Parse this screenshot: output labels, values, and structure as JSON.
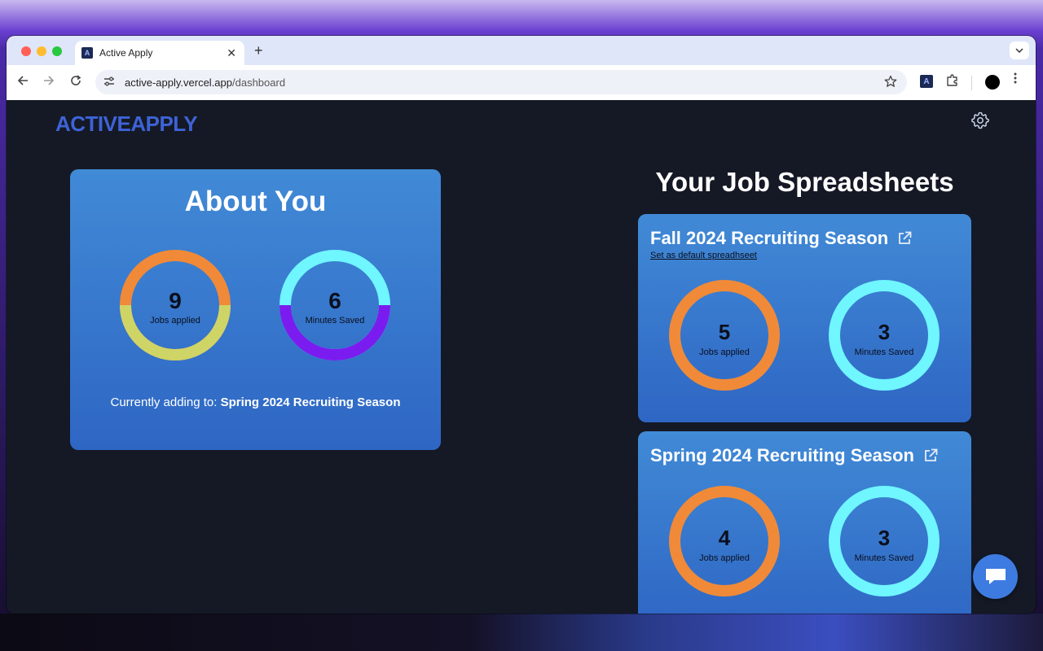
{
  "browser": {
    "tab_title": "Active Apply",
    "tab_favicon_letter": "A",
    "new_tab_symbol": "+",
    "close_symbol": "✕",
    "url_host": "active-apply.vercel.app",
    "url_path": "/dashboard"
  },
  "app": {
    "logo_text": "ACTIVEAPPLY",
    "brand_color": "#3e63d6"
  },
  "about": {
    "title": "About You",
    "jobs_applied": {
      "value": "9",
      "label": "Jobs applied"
    },
    "minutes_saved": {
      "value": "6",
      "label": "Minutes Saved"
    },
    "adding_prefix": "Currently adding to: ",
    "adding_value": "Spring 2024 Recruiting Season"
  },
  "sheets": {
    "title": "Your Job Spreadsheets",
    "items": [
      {
        "name": "Fall 2024 Recruiting Season",
        "default_link": "Set as default spreadhseet",
        "jobs_applied": {
          "value": "5",
          "label": "Jobs applied"
        },
        "minutes_saved": {
          "value": "3",
          "label": "Minutes Saved"
        }
      },
      {
        "name": "Spring 2024 Recruiting Season",
        "jobs_applied": {
          "value": "4",
          "label": "Jobs applied"
        },
        "minutes_saved": {
          "value": "3",
          "label": "Minutes Saved"
        }
      }
    ]
  },
  "colors": {
    "orange": "#f08a38",
    "yellow_green": "#cfd466",
    "cyan": "#6ff6ff",
    "purple": "#7a1cf0"
  }
}
